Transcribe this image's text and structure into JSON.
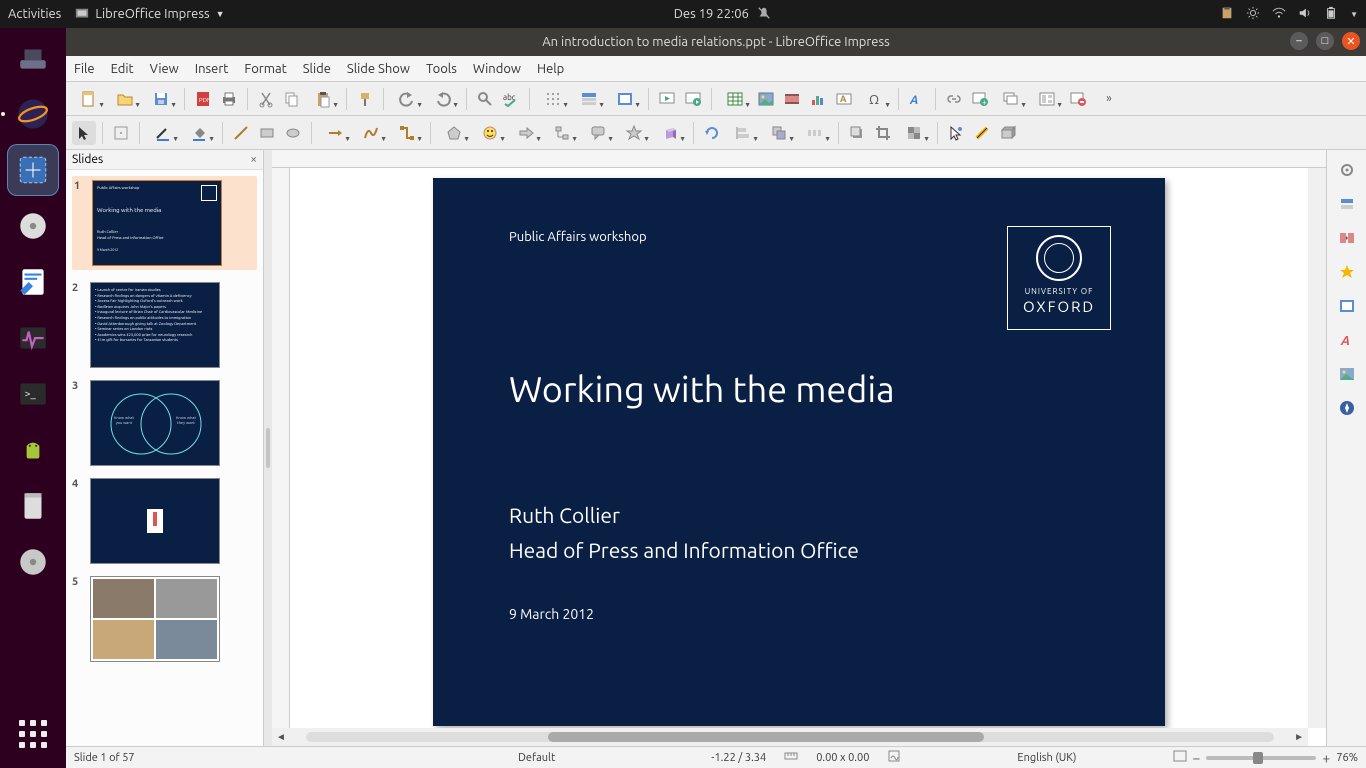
{
  "system": {
    "activities": "Activities",
    "app_label": "LibreOffice Impress",
    "clock": "Des 19  22:06"
  },
  "window": {
    "title": "An introduction to media relations.ppt - LibreOffice Impress"
  },
  "menubar": [
    "File",
    "Edit",
    "View",
    "Insert",
    "Format",
    "Slide",
    "Slide Show",
    "Tools",
    "Window",
    "Help"
  ],
  "slidespanel": {
    "title": "Slides",
    "close": "×"
  },
  "slide1": {
    "pretitle": "Public Affairs workshop",
    "title": "Working with the media",
    "author": "Ruth Collier",
    "role": "Head of Press and Information Office",
    "date": "9 March 2012",
    "logo_line1": "UNIVERSITY OF",
    "logo_line2": "OXFORD"
  },
  "thumb2_lines": [
    "Launch of centre for Iranian studies",
    "Research findings on dangers of vitamin A deficiency",
    "Access Fair highlighting Oxford's outreach work",
    "Bodleian acquires John Major's papers",
    "Inaugural lecture of Brian Chair of Cardiovascular Medicine",
    "Research findings on public attitudes to immigration",
    "David Attenborough giving talk at Zoology Department",
    "Seminar series on London riots",
    "Academics wins £25,000 prize for neurology research",
    "£1m gift for bursaries for Tanzanian students"
  ],
  "thumb3": {
    "left": "Know what you want",
    "right": "Know what they want"
  },
  "status": {
    "slide": "Slide 1 of 57",
    "master": "Default",
    "pos": "-1.22 / 3.34",
    "size": "0.00 x 0.00",
    "lang": "English (UK)",
    "zoom": "76%"
  },
  "colors": {
    "slide_bg": "#0a1f44",
    "launcher": "#2c001e",
    "close": "#e95420"
  }
}
